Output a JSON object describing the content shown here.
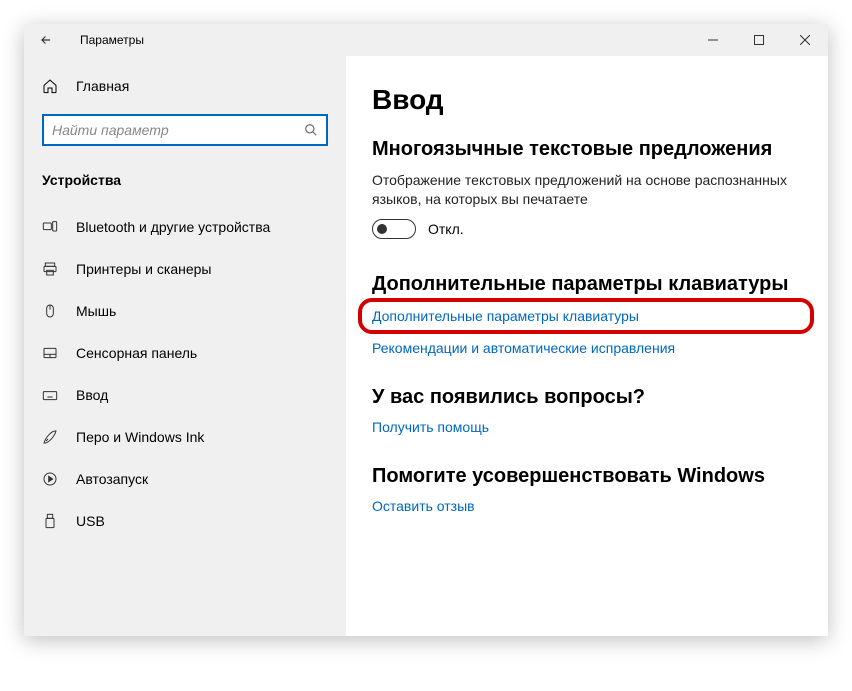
{
  "window": {
    "title": "Параметры"
  },
  "sidebar": {
    "home": "Главная",
    "search_placeholder": "Найти параметр",
    "category": "Устройства",
    "items": [
      {
        "label": "Bluetooth и другие устройства"
      },
      {
        "label": "Принтеры и сканеры"
      },
      {
        "label": "Мышь"
      },
      {
        "label": "Сенсорная панель"
      },
      {
        "label": "Ввод"
      },
      {
        "label": "Перо и Windows Ink"
      },
      {
        "label": "Автозапуск"
      },
      {
        "label": "USB"
      }
    ]
  },
  "main": {
    "title": "Ввод",
    "section1": {
      "heading": "Многоязычные текстовые предложения",
      "desc": "Отображение текстовых предложений на основе распознанных языков, на которых вы печатаете",
      "toggle_state": "Откл."
    },
    "section2": {
      "heading": "Дополнительные параметры клавиатуры",
      "link1": "Дополнительные параметры клавиатуры",
      "link2": "Рекомендации и автоматические исправления"
    },
    "section3": {
      "heading": "У вас появились вопросы?",
      "link": "Получить помощь"
    },
    "section4": {
      "heading": "Помогите усовершенствовать Windows",
      "link": "Оставить отзыв"
    }
  }
}
